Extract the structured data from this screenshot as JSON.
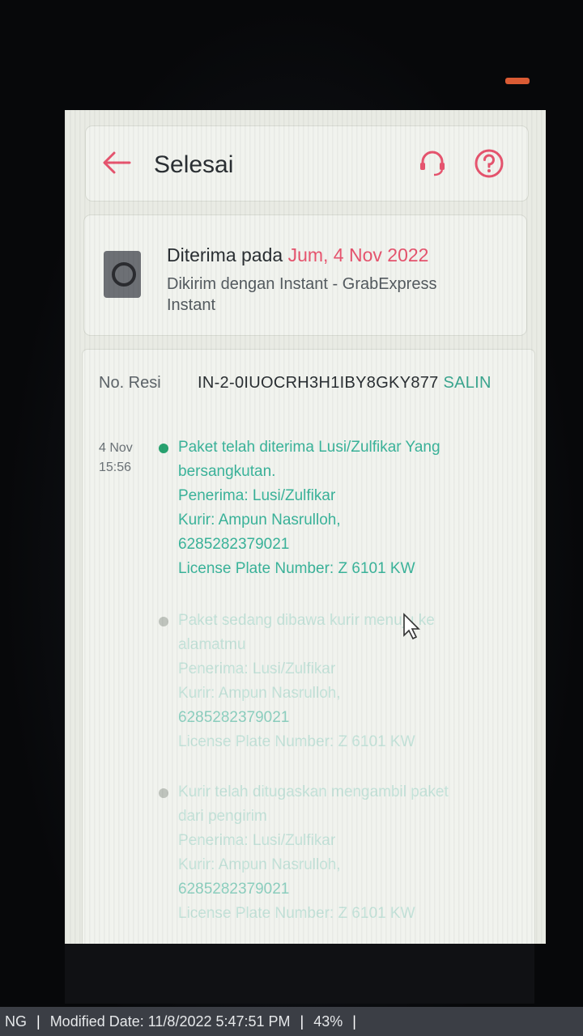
{
  "header": {
    "title": "Selesai",
    "accent_color": "#e6546e"
  },
  "delivery": {
    "received_label": "Diterima pada",
    "received_date": "Jum, 4 Nov 2022",
    "shipping_line1": "Dikirim dengan Instant - GrabExpress",
    "shipping_line2": "Instant"
  },
  "tracking": {
    "resi_label": "No. Resi",
    "resi_number": "IN-2-0IUOCRH3H1IBY8GKY877",
    "copy_label": "SALIN",
    "events": [
      {
        "date": "4 Nov",
        "time": "15:56",
        "lines": [
          "Paket telah diterima Lusi/Zulfikar Yang",
          "bersangkutan.",
          "Penerima: Lusi/Zulfikar",
          "Kurir: Ampun Nasrulloh,",
          "6285282379021",
          "License Plate Number: Z 6101 KW"
        ]
      },
      {
        "lines": [
          "Paket sedang dibawa kurir menuju ke",
          "alamatmu",
          "Penerima: Lusi/Zulfikar",
          "Kurir: Ampun Nasrulloh,",
          "6285282379021",
          "License Plate Number: Z 6101 KW"
        ]
      },
      {
        "lines": [
          "Kurir telah ditugaskan mengambil paket",
          "dari pengirim",
          "Penerima: Lusi/Zulfikar",
          "Kurir: Ampun Nasrulloh,",
          "6285282379021",
          "License Plate Number: Z 6101 KW"
        ]
      }
    ]
  },
  "statusbar": {
    "left_fragment": "NG",
    "modified": "Modified Date: 11/8/2022 5:47:51 PM",
    "zoom": "43%"
  }
}
